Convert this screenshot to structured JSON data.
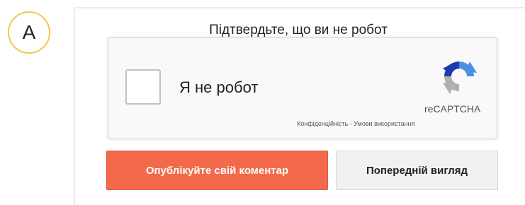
{
  "marker": {
    "label": "A"
  },
  "captcha": {
    "prompt": "Підтвердьте, що ви не робот",
    "checkbox_label": "Я не робот",
    "checked": false,
    "brand": "reCAPTCHA",
    "privacy_link": "Конфіденційність",
    "separator": " - ",
    "terms_link": "Умови використання"
  },
  "actions": {
    "publish_label": "Опублікуйте свій коментар",
    "preview_label": "Попередній вигляд"
  },
  "colors": {
    "accent": "#f26a4b",
    "marker_ring": "#f2c94c",
    "recaptcha_blue": "#4a90e2",
    "recaptcha_dark_blue": "#1c3aa9",
    "recaptcha_gray": "#b0b0b0"
  }
}
